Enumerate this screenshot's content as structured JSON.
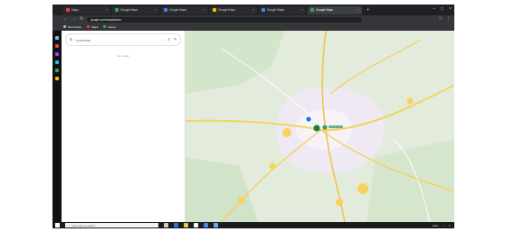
{
  "browser": {
    "tabs": [
      {
        "label": "Maps",
        "color": "#ea4335"
      },
      {
        "label": "Google Maps",
        "color": "#34a853"
      },
      {
        "label": "Google Maps",
        "color": "#4285f4"
      },
      {
        "label": "Google Maps",
        "color": "#fbbc04"
      },
      {
        "label": "Google Maps",
        "color": "#4285f4"
      },
      {
        "label": "Google Maps",
        "color": "#34a853",
        "active": true
      }
    ],
    "address": "google.com/maps/place",
    "bookmarks": [
      "Bookmarks",
      "Maps",
      "Saved"
    ]
  },
  "maps": {
    "search_value": "Lucknow",
    "panel_hint": "No results"
  },
  "taskbar": {
    "search_placeholder": "Type here to search",
    "tray_text": "ENG"
  },
  "colors": {
    "accent": "#1a73e8",
    "map_green": "#cfe3c6",
    "map_land": "#e8eee2",
    "city": "#f2f0f7",
    "road_yellow": "#f6c94c"
  }
}
